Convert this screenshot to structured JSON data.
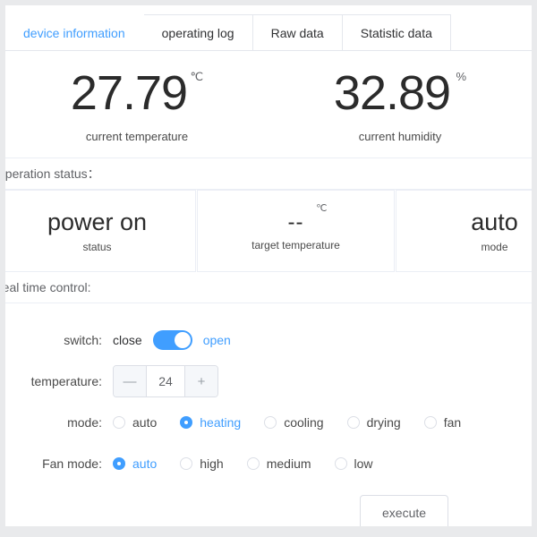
{
  "tabs": [
    {
      "label": "device information",
      "active": true
    },
    {
      "label": "operating log",
      "active": false
    },
    {
      "label": "Raw data",
      "active": false
    },
    {
      "label": "Statistic data",
      "active": false
    }
  ],
  "readings": [
    {
      "value": "27.79",
      "unit": "℃",
      "label": "current temperature"
    },
    {
      "value": "32.89",
      "unit": "%",
      "label": "current humidity"
    }
  ],
  "operation_status": {
    "heading": "operation status：",
    "cards": [
      {
        "value": "power on",
        "unit": "",
        "label": "status"
      },
      {
        "value": "--",
        "unit": "℃",
        "label": "target temperature"
      },
      {
        "value": "auto",
        "unit": "",
        "label": "mode"
      }
    ]
  },
  "real_time_control": {
    "heading": "real time control:",
    "switch": {
      "label": "switch:",
      "off_text": "close",
      "on_text": "open",
      "state": "on"
    },
    "temperature": {
      "label": "temperature:",
      "minus": "—",
      "value": "24",
      "plus": "+"
    },
    "mode": {
      "label": "mode:",
      "options": [
        {
          "label": "auto",
          "checked": false
        },
        {
          "label": "heating",
          "checked": true
        },
        {
          "label": "cooling",
          "checked": false
        },
        {
          "label": "drying",
          "checked": false
        },
        {
          "label": "fan",
          "checked": false
        }
      ]
    },
    "fan_mode": {
      "label": "Fan mode:",
      "options": [
        {
          "label": "auto",
          "checked": true
        },
        {
          "label": "high",
          "checked": false
        },
        {
          "label": "medium",
          "checked": false
        },
        {
          "label": "low",
          "checked": false
        }
      ]
    },
    "execute_label": "execute"
  },
  "colors": {
    "accent": "#409eff",
    "text": "#4a4a4a",
    "value": "#2b2b2b",
    "border": "#e4e7ed",
    "page_bg": "#e9eaec"
  }
}
